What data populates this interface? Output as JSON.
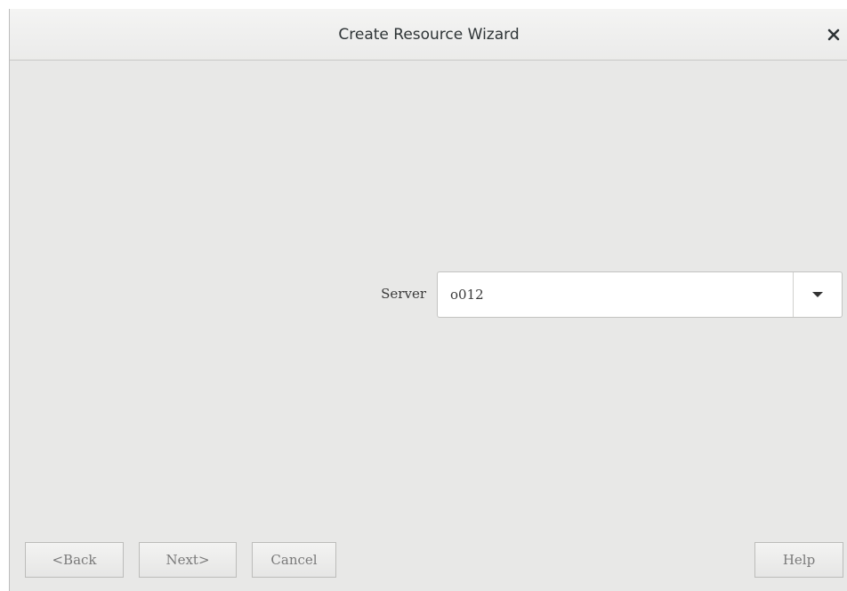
{
  "window": {
    "title": "Create Resource Wizard",
    "close_icon": "close-icon"
  },
  "form": {
    "server_label": "Server",
    "server_value": "o012",
    "dropdown_icon": "chevron-down-icon"
  },
  "buttons": {
    "back": "<Back",
    "next": "Next>",
    "cancel": "Cancel",
    "help": "Help"
  },
  "colors": {
    "background": "#e8e8e7",
    "titlebar": "#f1f1f0",
    "field": "#ffffff",
    "text": "#2e3436"
  }
}
